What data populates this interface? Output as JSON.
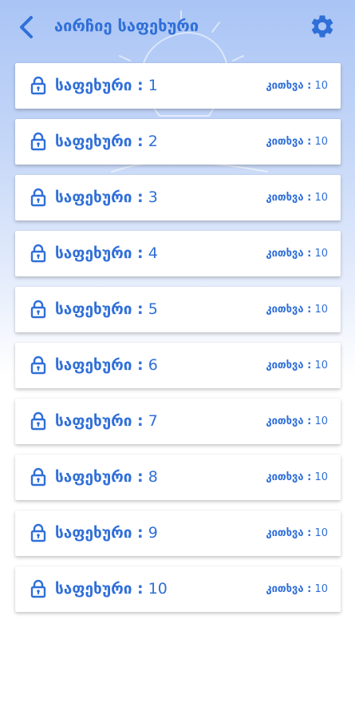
{
  "header": {
    "title": "აირჩიე საფეხური",
    "back_icon": "chevron-left-icon",
    "settings_icon": "gear-icon"
  },
  "colors": {
    "accent": "#2f6fd8",
    "background_top": "#a9c4f5",
    "card": "#ffffff"
  },
  "levels": [
    {
      "label": "საფეხური :",
      "number": "1",
      "questions_label": "კითხვა :",
      "questions": "10",
      "locked": true
    },
    {
      "label": "საფეხური :",
      "number": "2",
      "questions_label": "კითხვა :",
      "questions": "10",
      "locked": true
    },
    {
      "label": "საფეხური :",
      "number": "3",
      "questions_label": "კითხვა :",
      "questions": "10",
      "locked": true
    },
    {
      "label": "საფეხური :",
      "number": "4",
      "questions_label": "კითხვა :",
      "questions": "10",
      "locked": true
    },
    {
      "label": "საფეხური :",
      "number": "5",
      "questions_label": "კითხვა :",
      "questions": "10",
      "locked": true
    },
    {
      "label": "საფეხური :",
      "number": "6",
      "questions_label": "კითხვა :",
      "questions": "10",
      "locked": true
    },
    {
      "label": "საფეხური :",
      "number": "7",
      "questions_label": "კითხვა :",
      "questions": "10",
      "locked": true
    },
    {
      "label": "საფეხური :",
      "number": "8",
      "questions_label": "კითხვა :",
      "questions": "10",
      "locked": true
    },
    {
      "label": "საფეხური :",
      "number": "9",
      "questions_label": "კითხვა :",
      "questions": "10",
      "locked": true
    },
    {
      "label": "საფეხური :",
      "number": "10",
      "questions_label": "კითხვა :",
      "questions": "10",
      "locked": true
    }
  ]
}
